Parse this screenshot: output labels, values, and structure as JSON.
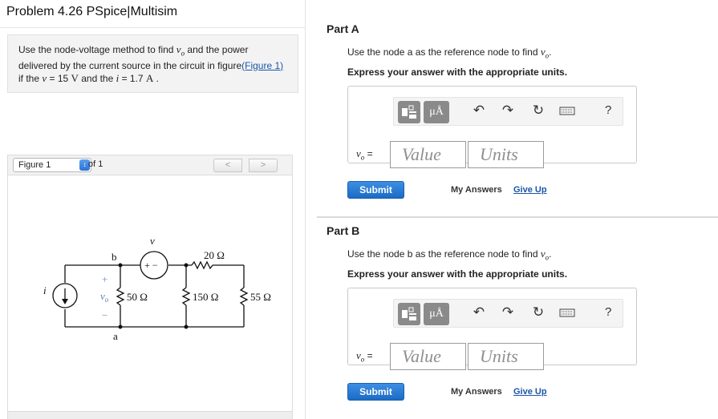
{
  "problem": {
    "title": "Problem 4.26 PSpice|Multisim",
    "text_1": "Use the node-voltage method to find ",
    "var_vo": "v",
    "var_vo_sub": "o",
    "text_2": " and the power delivered by the current source in the circuit in figure",
    "figure_link": "(Figure 1)",
    "text_3": " if the ",
    "var_v": "v",
    "text_4": " = 15 ",
    "unit_V": "V",
    "text_5": " and the ",
    "var_i": "i",
    "text_6": " = 1.7 ",
    "unit_A": "A",
    "text_7": " ."
  },
  "figure": {
    "select_label": "Figure 1",
    "of_label": "of 1",
    "prev_label": "<",
    "next_label": ">",
    "circuit": {
      "source_v": "v",
      "source_i": "i",
      "node_b": "b",
      "node_a": "a",
      "plus_minus_source": "+ −",
      "r_top": "20 Ω",
      "r1": "50 Ω",
      "r2": "150 Ω",
      "r3": "55 Ω",
      "vo_label": "v",
      "vo_sub": "o",
      "plus": "+",
      "minus": "−"
    }
  },
  "parts": [
    {
      "label": "Part A",
      "instruction_1": "Use the node a as the reference node to find ",
      "instruction_var": "v",
      "instruction_sub": "o",
      "instruction_2": ".",
      "units_hint": "Express your answer with the appropriate units.",
      "var_label": "v",
      "var_sub": "o",
      "equals": "=",
      "value_placeholder": "Value",
      "units_placeholder": "Units",
      "submit": "Submit",
      "my_answers": "My Answers",
      "give_up": "Give Up"
    },
    {
      "label": "Part B",
      "instruction_1": "Use the node b as the reference node to find ",
      "instruction_var": "v",
      "instruction_sub": "o",
      "instruction_2": ".",
      "units_hint": "Express your answer with the appropriate units.",
      "var_label": "v",
      "var_sub": "o",
      "equals": "=",
      "value_placeholder": "Value",
      "units_placeholder": "Units",
      "submit": "Submit",
      "my_answers": "My Answers",
      "give_up": "Give Up"
    }
  ],
  "toolbar": {
    "mu_label": "μÅ",
    "help_label": "?",
    "icons": [
      "templates-icon",
      "units-icon",
      "undo-icon",
      "redo-icon",
      "reset-icon",
      "keyboard-icon",
      "help-icon"
    ]
  },
  "colors": {
    "submit": "#1c6bc4",
    "link": "#1a56a6"
  }
}
